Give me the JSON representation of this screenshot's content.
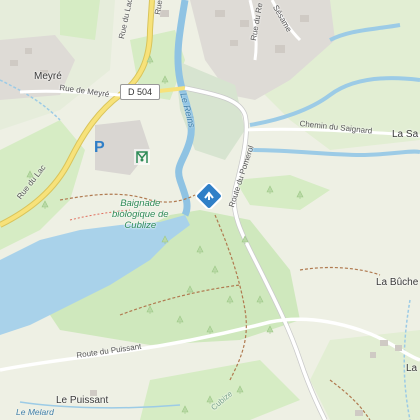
{
  "places": {
    "meyre": "Meyré",
    "la_buche": "La Bûche",
    "le_puissant": "Le Puissant",
    "la_sa": "La Sa",
    "la_right": "La"
  },
  "roads": {
    "rue_du_lac": "Rue du Lac",
    "rue_de_meyre": "Rue de Meyré",
    "d504": "D 504",
    "route_du_pomerol": "Route du Pomerol",
    "chemin_du_saignard": "Chemin du Saignard",
    "route_du_puissant": "Route du Puissant",
    "rue_du_re": "Rue du Re",
    "sesame": "Sésame",
    "rue_du_top": "Rue du",
    "cubize": "Cubize"
  },
  "water": {
    "le_reins": "Le Reins",
    "le_melard": "Le Melard"
  },
  "poi": {
    "baignade_line1": "Baignade",
    "baignade_line2": "biologique de",
    "baignade_line3": "Cublize",
    "parking_letter": "P"
  },
  "icons": {
    "parking": "parking-icon",
    "playground": "playground-icon",
    "marker": "location-marker-icon",
    "trees": "tree-icon"
  },
  "colors": {
    "background": "#eef0e4",
    "forest": "#d6ecc4",
    "meadow": "#e4efd6",
    "lake": "#a9d2ea",
    "river": "#8fc3e3",
    "marker": "#2f7fc7",
    "road_main": "#ffffff",
    "road_yellow": "#f7e27a",
    "track": "#b07a50",
    "built": "#d9d6d2",
    "poi_text": "#2e8b57"
  }
}
